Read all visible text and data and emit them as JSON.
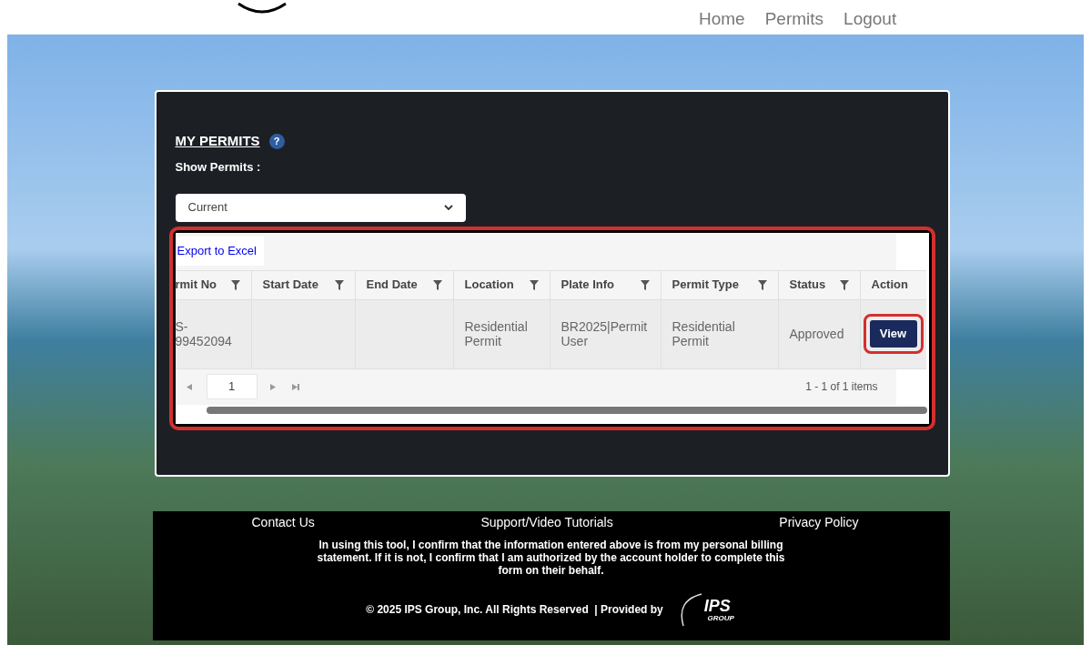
{
  "nav": {
    "items": [
      "Home",
      "Permits",
      "Logout"
    ]
  },
  "panel": {
    "title": "MY PERMITS",
    "help": "?",
    "filter_label": "Show Permits :",
    "filter": {
      "value": "Current"
    }
  },
  "grid": {
    "export_link": "Export to Excel",
    "columns": [
      {
        "label": "rmit No",
        "filter": true
      },
      {
        "label": "Start Date",
        "filter": true
      },
      {
        "label": "End Date",
        "filter": true
      },
      {
        "label": "Location",
        "filter": true
      },
      {
        "label": "Plate Info",
        "filter": true
      },
      {
        "label": "Permit Type",
        "filter": true
      },
      {
        "label": "Status",
        "filter": true
      },
      {
        "label": "Action",
        "filter": false
      }
    ],
    "rows": [
      {
        "cells": [
          "S-\n99452094",
          "",
          "",
          "Residential\nPermit",
          "BR2025|Permit\nUser",
          "Residential\nPermit",
          "Approved"
        ],
        "action": "View"
      }
    ],
    "pager": {
      "page": "1",
      "summary": "1 - 1 of 1 items"
    }
  },
  "footer": {
    "links": [
      "Contact Us",
      "Support/Video Tutorials",
      "Privacy Policy"
    ],
    "notice": "In using this tool, I confirm that the information entered above is from my personal billing statement. If it is not, I confirm that I am authorized by the account holder to complete this form on their behalf.",
    "copyright": "© 2025 IPS Group, Inc. All Rights Reserved  | Provided by",
    "logo": {
      "main": "IPS",
      "sub": "GROUP"
    }
  }
}
